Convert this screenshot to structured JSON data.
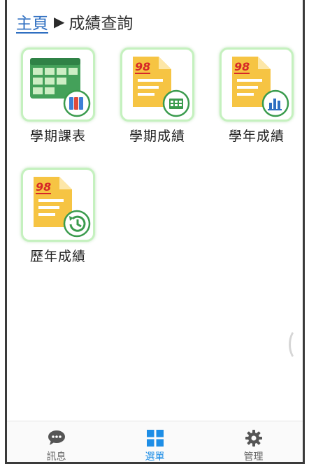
{
  "breadcrumb": {
    "home": "主頁",
    "separator": "▶",
    "current": "成績查詢"
  },
  "tiles": [
    {
      "label": "學期課表",
      "icon": "timetable-books-icon"
    },
    {
      "label": "學期成績",
      "icon": "score-calendar-icon"
    },
    {
      "label": "學年成績",
      "icon": "score-chart-icon"
    },
    {
      "label": "歷年成績",
      "icon": "score-history-icon"
    }
  ],
  "tabs": [
    {
      "label": "訊息",
      "icon": "chat-icon",
      "active": false
    },
    {
      "label": "選單",
      "icon": "grid-icon",
      "active": true
    },
    {
      "label": "管理",
      "icon": "gear-icon",
      "active": false
    }
  ],
  "score_badge": "98",
  "colors": {
    "accent": "#1e8ee6",
    "tile_border": "#c5f1bf",
    "paper": "#f6c443",
    "badge_green": "#3a9b4d"
  }
}
